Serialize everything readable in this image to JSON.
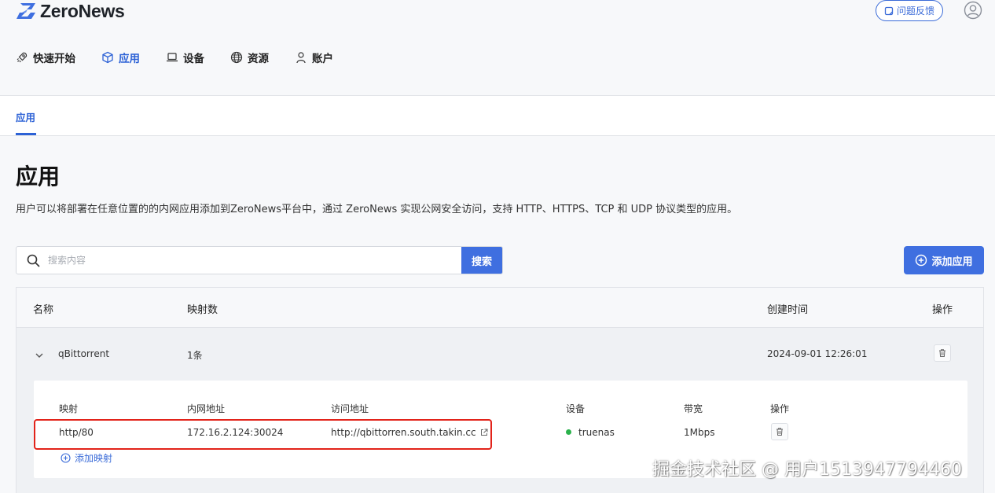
{
  "brand": {
    "name": "ZeroNews"
  },
  "header": {
    "feedback_label": "问题反馈",
    "user_icon": "user-circle-icon"
  },
  "nav": {
    "items": [
      {
        "label": "快速开始",
        "icon": "rocket-icon",
        "active": false
      },
      {
        "label": "应用",
        "icon": "cube-icon",
        "active": true
      },
      {
        "label": "设备",
        "icon": "laptop-icon",
        "active": false
      },
      {
        "label": "资源",
        "icon": "globe-icon",
        "active": false
      },
      {
        "label": "账户",
        "icon": "user-icon",
        "active": false
      }
    ]
  },
  "tabs": [
    {
      "label": "应用",
      "active": true
    }
  ],
  "page": {
    "title": "应用",
    "description": "用户可以将部署在任意位置的的内网应用添加到ZeroNews平台中，通过 ZeroNews 实现公网安全访问，支持 HTTP、HTTPS、TCP 和 UDP 协议类型的应用。"
  },
  "search": {
    "placeholder": "搜索内容",
    "value": "",
    "button_label": "搜索"
  },
  "add_app_label": "添加应用",
  "table": {
    "columns": {
      "name": "名称",
      "mappings": "映射数",
      "created": "创建时间",
      "actions": "操作"
    },
    "rows": [
      {
        "name": "qBittorrent",
        "mapping_count": "1条",
        "created_at": "2024-09-01 12:26:01",
        "expanded": true,
        "sub_columns": {
          "mapping": "映射",
          "lan_address": "内网地址",
          "access_address": "访问地址",
          "device": "设备",
          "bandwidth": "带宽",
          "actions": "操作"
        },
        "mappings": [
          {
            "mapping": "http/80",
            "lan_address": "172.16.2.124:30024",
            "access_address": "http://qbittorren.south.takin.cc",
            "device": "truenas",
            "device_status_color": "#2bb24c",
            "bandwidth": "1Mbps"
          }
        ],
        "add_mapping_label": "添加映射"
      }
    ]
  },
  "colors": {
    "accent": "#3f6fe0",
    "highlight": "#e2231a"
  },
  "watermark": "掘金技术社区 @ 用户1513947794460"
}
